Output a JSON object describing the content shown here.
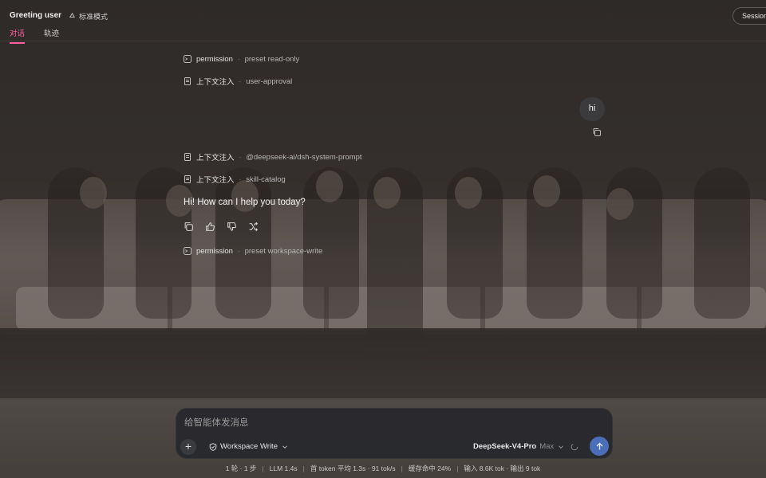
{
  "header": {
    "title": "Greeting user",
    "mode_label": "标准模式",
    "session_button": "Session log",
    "tabs": [
      {
        "label": "对话",
        "active": true
      },
      {
        "label": "轨迹",
        "active": false
      }
    ]
  },
  "events": [
    {
      "icon": "terminal-icon",
      "key": "permission",
      "value": "preset read-only"
    },
    {
      "icon": "document-icon",
      "key": "上下文注入",
      "value": "user-approval"
    },
    {
      "icon": "document-icon",
      "key": "上下文注入",
      "value": "@deepseek-ai/dsh-system-prompt"
    },
    {
      "icon": "document-icon",
      "key": "上下文注入",
      "value": "skill-catalog"
    },
    {
      "icon": "terminal-icon",
      "key": "permission",
      "value": "preset workspace-write"
    }
  ],
  "user_message": "hi",
  "assistant_message": "Hi! How can I help you today?",
  "composer": {
    "placeholder": "给智能体发消息",
    "workspace_mode": "Workspace Write",
    "model_name": "DeepSeek-V4-Pro",
    "model_tier": "Max"
  },
  "status": {
    "turns": "1 轮 · 1 步",
    "llm": "LLM 1.4s",
    "first_token": "首 token 平均 1.3s · 91 tok/s",
    "cache": "缓存命中 24%",
    "io": "输入 8.6K tok · 输出 9 tok"
  },
  "colors": {
    "accent": "#ff5fa2",
    "send": "#4a6fb8"
  }
}
